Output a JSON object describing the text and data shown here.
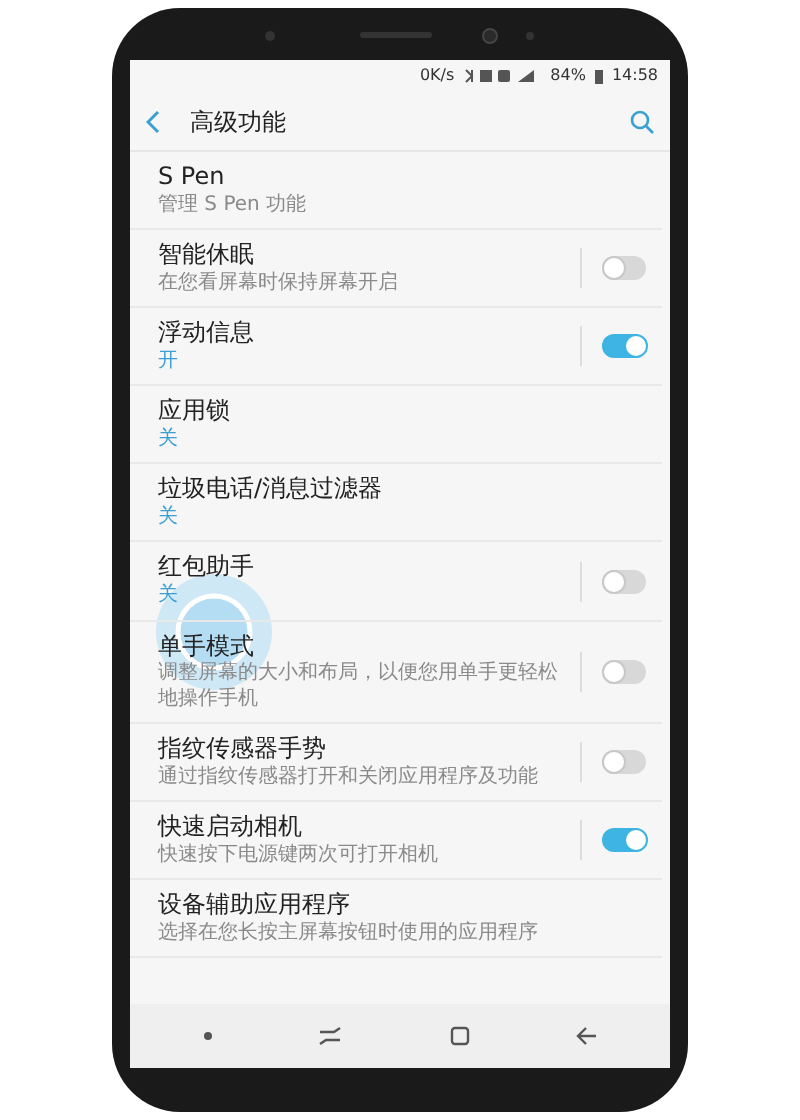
{
  "status_bar": {
    "speed": "0K/s",
    "battery": "84%",
    "time": "14:58"
  },
  "header": {
    "title": "高级功能"
  },
  "items": [
    {
      "kind": "link",
      "title": "S Pen",
      "description": "管理 S Pen 功能"
    },
    {
      "kind": "toggle",
      "title": "智能休眠",
      "description": "在您看屏幕时保持屏幕开启",
      "on": false
    },
    {
      "kind": "toggle",
      "title": "浮动信息",
      "value": "开",
      "on": true
    },
    {
      "kind": "link",
      "title": "应用锁",
      "value": "关"
    },
    {
      "kind": "link",
      "title": "垃圾电话/消息过滤器",
      "value": "关"
    },
    {
      "kind": "toggle",
      "title": "红包助手",
      "value": "关",
      "on": false
    },
    {
      "kind": "toggle",
      "title": "单手模式",
      "description": "调整屏幕的大小和布局，以便您用单手更轻松地操作手机",
      "on": false
    },
    {
      "kind": "toggle",
      "title": "指纹传感器手势",
      "description": "通过指纹传感器打开和关闭应用程序及功能",
      "on": false
    },
    {
      "kind": "toggle",
      "title": "快速启动相机",
      "description": "快速按下电源键两次可打开相机",
      "on": true
    },
    {
      "kind": "link",
      "title": "设备辅助应用程序",
      "description": "选择在您长按主屏幕按钮时使用的应用程序"
    }
  ]
}
